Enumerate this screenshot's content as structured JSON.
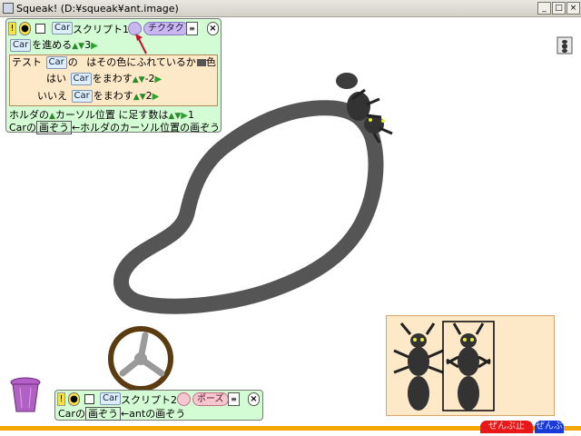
{
  "window": {
    "title": "Squeak! (D:¥squeak¥ant.image)",
    "buttons": {
      "minimize": "_",
      "maximize": "□",
      "close": "×"
    }
  },
  "script1": {
    "header": {
      "bang": "!",
      "car_chip": "Car",
      "name": "スクリプト1",
      "tick_label": "チクタク"
    },
    "line_forward": {
      "car": "Car",
      "verb": "を進める",
      "value": "3"
    },
    "test_block": {
      "label": "テスト",
      "car": "Car",
      "text": "の",
      "condition": "はその色にふれているか",
      "color_label": "色",
      "yes_label": "はい",
      "yes_car": "Car",
      "yes_verb": "をまわす",
      "yes_value": "-2",
      "no_label": "いいえ",
      "no_car": "Car",
      "no_verb": "をまわす",
      "no_value": "2"
    },
    "line_holder": {
      "prefix": "ホルダの",
      "middle": "カーソル位置",
      "suffix": "に足す数は",
      "value": "1"
    },
    "line_image": {
      "car": "Car",
      "part1": "の",
      "image": "画ぞう",
      "arrow": "←",
      "holder": "ホルダの",
      "part2": "カーソル位置",
      "part3": "の画ぞう"
    }
  },
  "script2": {
    "header": {
      "bang": "!",
      "car_chip": "Car",
      "name": "スクリプト2",
      "pause_label": "ポーズ"
    },
    "line_image": {
      "car": "Car",
      "part1": "の",
      "image": "画ぞう",
      "arrow": "←",
      "ant": "ant",
      "part2": "の画ぞう"
    }
  },
  "bottom_buttons": {
    "stop_label": "ぜんぶ止",
    "go_label": "ぜんぶ"
  },
  "colors": {
    "track": "#555555",
    "wheel": "#5a3c10",
    "script_bg": "#d4fcd4",
    "test_bg": "#fde8c8",
    "holder_bg": "#fde8c8",
    "accent_orange": "#f6a600"
  }
}
